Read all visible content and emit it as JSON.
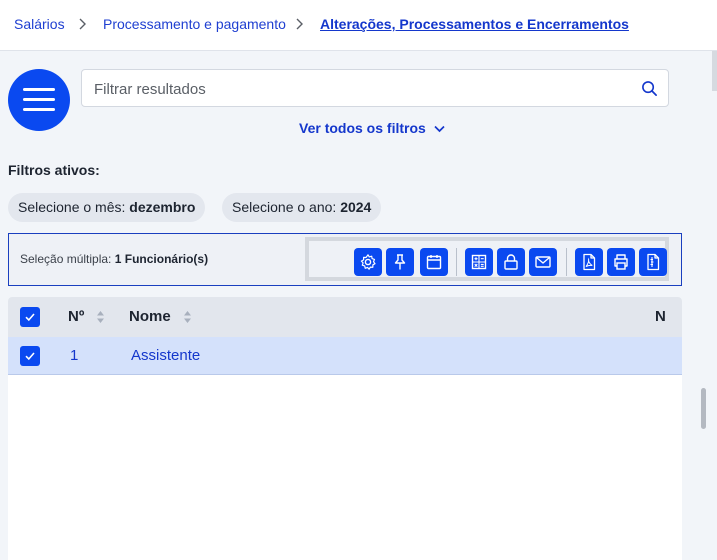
{
  "breadcrumb": {
    "items": [
      "Salários",
      "Processamento e pagamento"
    ],
    "current": "Alterações, Processamentos e Encerramentos"
  },
  "search": {
    "placeholder": "Filtrar resultados"
  },
  "filters_link": "Ver todos os filtros",
  "active_filters": {
    "title": "Filtros ativos:",
    "chips": [
      {
        "label": "Selecione o mês:",
        "value": "dezembro"
      },
      {
        "label": "Selecione o ano:",
        "value": "2024"
      }
    ]
  },
  "selection": {
    "label": "Seleção múltipla:",
    "count": "1 Funcionário(s)",
    "toolbar": [
      "gear-icon",
      "pin-icon",
      "calendar-icon",
      "calculator-icon",
      "lock-icon",
      "mail-icon",
      "pdf-icon",
      "print-icon",
      "document-icon"
    ]
  },
  "table": {
    "columns": [
      "Nº",
      "Nome",
      "N"
    ],
    "rows": [
      {
        "number": "1",
        "name": "Assistente",
        "selected": true
      }
    ]
  },
  "colors": {
    "primary": "#0a49f0",
    "link": "#1437cc",
    "selected_row": "#d4e1fb"
  }
}
